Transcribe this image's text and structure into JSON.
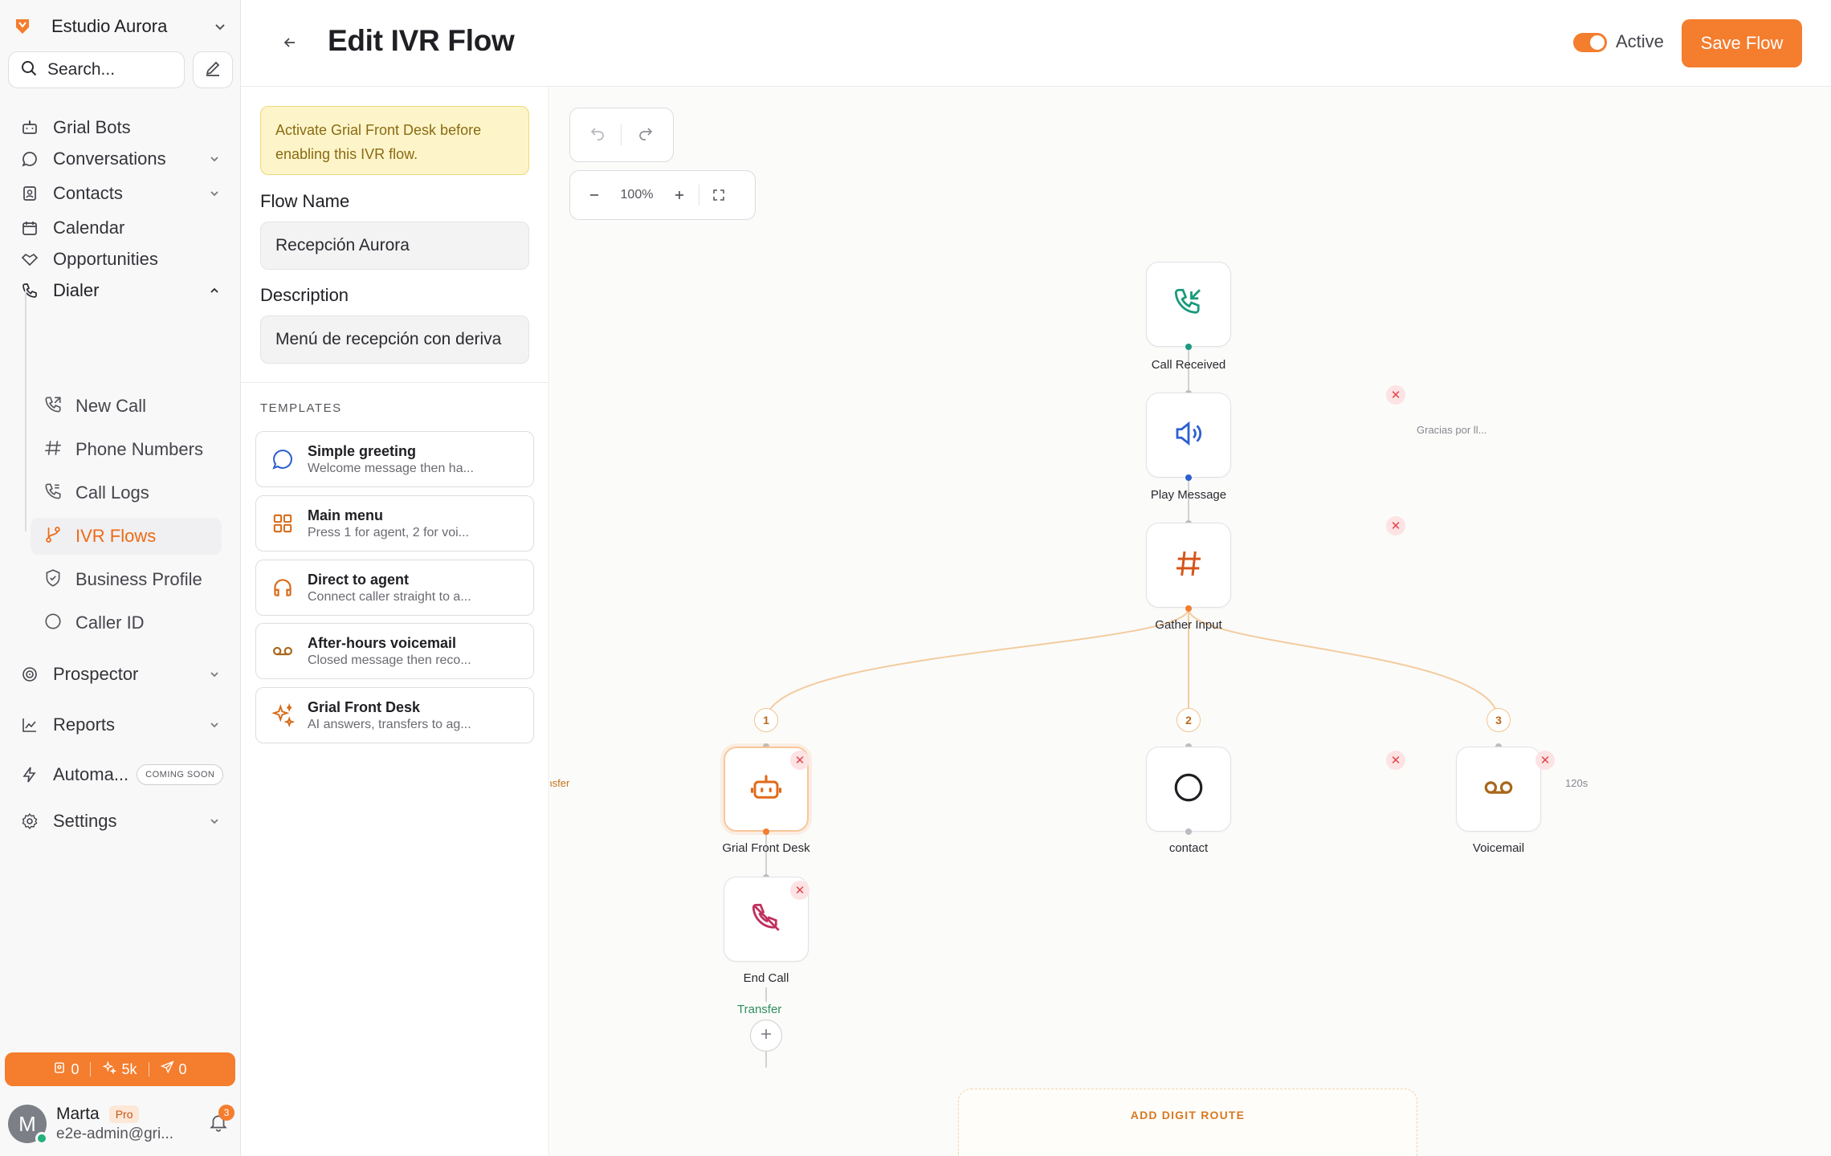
{
  "workspace": {
    "name": "Estudio Aurora"
  },
  "search": {
    "placeholder": "Search..."
  },
  "nav": {
    "bots": "Grial Bots",
    "conversations": "Conversations",
    "contacts": "Contacts",
    "calendar": "Calendar",
    "opportunities": "Opportunities",
    "dialer": "Dialer",
    "dialer_items": {
      "new_call": "New Call",
      "phone_numbers": "Phone Numbers",
      "call_logs": "Call Logs",
      "ivr_flows": "IVR Flows",
      "business_profile": "Business Profile",
      "caller_id": "Caller ID"
    },
    "prospector": "Prospector",
    "reports": "Reports",
    "automations": "Automa...",
    "automations_badge": "COMING SOON",
    "settings": "Settings"
  },
  "credits": {
    "contacts": "0",
    "ai": "5k",
    "sends": "0"
  },
  "user": {
    "initial": "M",
    "name": "Marta",
    "plan": "Pro",
    "email": "e2e-admin@gri...",
    "notifications": "3"
  },
  "header": {
    "title": "Edit IVR Flow",
    "active_label": "Active",
    "save_label": "Save Flow"
  },
  "panel": {
    "warning": "Activate Grial Front Desk before enabling this IVR flow.",
    "flow_name_label": "Flow Name",
    "flow_name_value": "Recepción Aurora",
    "description_label": "Description",
    "description_value": "Menú de recepción con deriva",
    "templates_heading": "TEMPLATES",
    "templates": [
      {
        "title": "Simple greeting",
        "subtitle": "Welcome message then ha..."
      },
      {
        "title": "Main menu",
        "subtitle": "Press 1 for agent, 2 for voi..."
      },
      {
        "title": "Direct to agent",
        "subtitle": "Connect caller straight to a..."
      },
      {
        "title": "After-hours voicemail",
        "subtitle": "Closed message then reco..."
      },
      {
        "title": "Grial Front Desk",
        "subtitle": "AI answers, transfers to ag..."
      }
    ]
  },
  "canvas": {
    "zoom": "100%",
    "nodes": {
      "call_received": "Call Received",
      "play_message": "Play Message",
      "play_message_note": "Gracias por ll...",
      "gather_input": "Gather Input",
      "front_desk": "Grial Front Desk",
      "front_desk_note": "No transfer",
      "contact": "contact",
      "voicemail": "Voicemail",
      "voicemail_note": "120s",
      "end_call": "End Call",
      "transfer": "Transfer"
    },
    "routes": [
      "1",
      "2",
      "3"
    ],
    "add_digit_route": "ADD DIGIT ROUTE"
  },
  "colors": {
    "accent": "#f47d2e",
    "teal": "#1a9a7d",
    "blue": "#2d5fd1",
    "magenta": "#c0305e"
  }
}
